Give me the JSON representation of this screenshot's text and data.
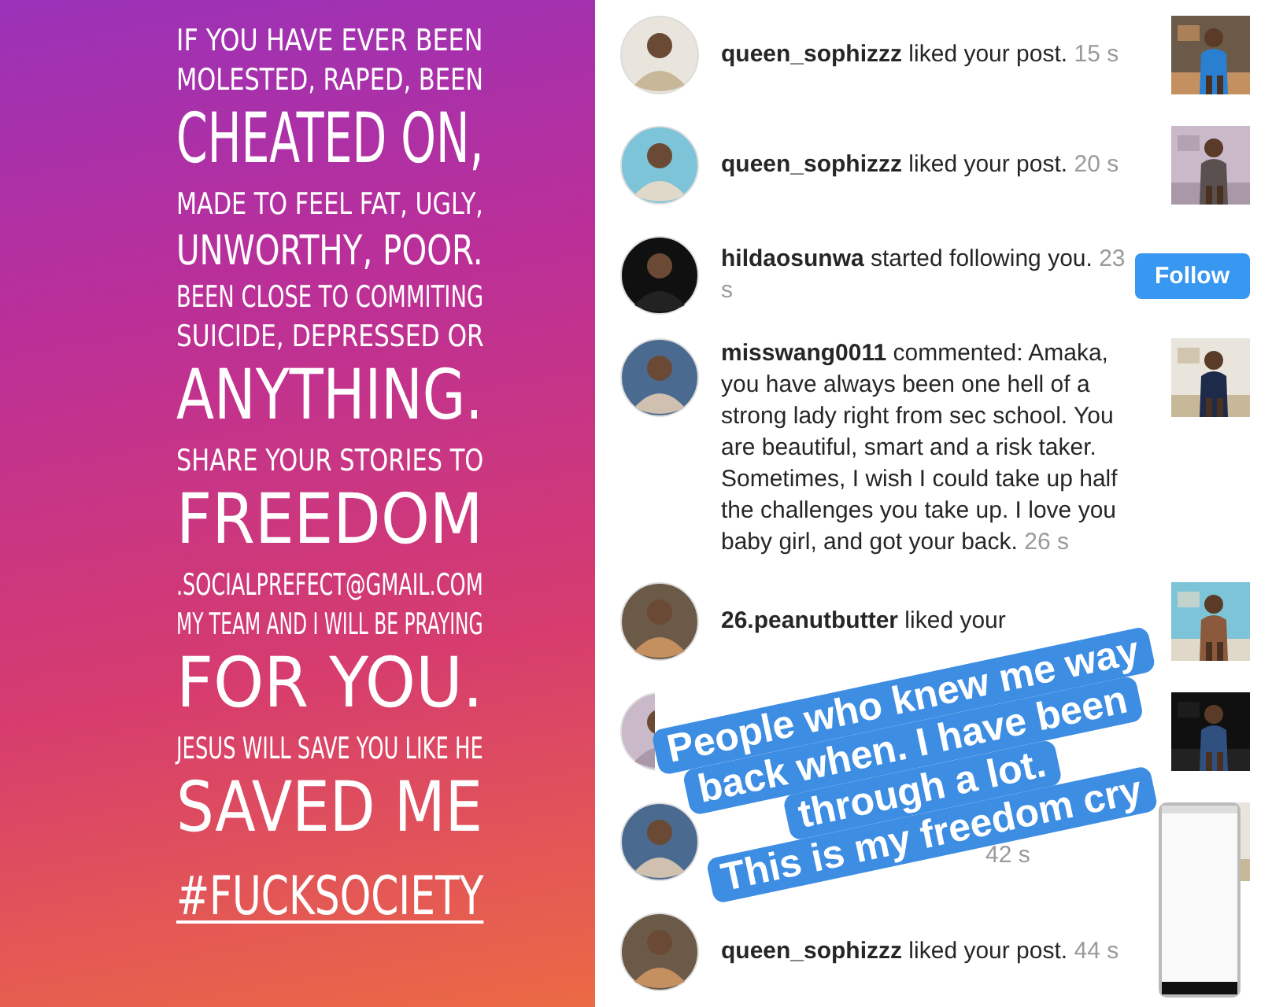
{
  "story": {
    "lines": [
      {
        "text": "IF YOU HAVE EVER BEEN",
        "kind": "small"
      },
      {
        "text": "MOLESTED, RAPED, BEEN",
        "kind": "small"
      },
      {
        "text": "CHEATED ON,",
        "kind": "large"
      },
      {
        "text": "MADE TO FEEL FAT, UGLY,",
        "kind": "small"
      },
      {
        "text": "UNWORTHY, POOR.",
        "kind": "medium"
      },
      {
        "text": "BEEN CLOSE TO COMMITING",
        "kind": "small"
      },
      {
        "text": "SUICIDE, DEPRESSED OR",
        "kind": "small"
      },
      {
        "text": "ANYTHING.",
        "kind": "large"
      },
      {
        "text": "SHARE YOUR STORIES TO",
        "kind": "small"
      },
      {
        "text": "FREEDOM",
        "kind": "large"
      },
      {
        "text": ".SOCIALPREFECT@GMAIL.COM",
        "kind": "small"
      },
      {
        "text": "MY TEAM AND I WILL BE PRAYING",
        "kind": "small"
      },
      {
        "text": "FOR YOU.",
        "kind": "large"
      },
      {
        "text": "JESUS WILL SAVE YOU LIKE HE",
        "kind": "small"
      },
      {
        "text": "SAVED ME",
        "kind": "large"
      },
      {
        "text": "#FUCKSOCIETY",
        "kind": "hashtag"
      }
    ]
  },
  "notifications": [
    {
      "kind": "activity",
      "user": "queen_sophizzz",
      "action": "liked your post.",
      "time": "15 s",
      "trailing": {
        "kind": "thumbnail"
      }
    },
    {
      "kind": "activity",
      "user": "queen_sophizzz",
      "action": "liked your post.",
      "time": "20 s",
      "trailing": {
        "kind": "thumbnail"
      }
    },
    {
      "kind": "activity",
      "user": "hildaosunwa",
      "action": "started following you.",
      "time": "23 s",
      "trailing": {
        "kind": "follow",
        "label": "Follow"
      }
    },
    {
      "kind": "activity",
      "user": "misswang0011",
      "action": "commented: Amaka, you have always been one hell of a strong lady right from sec school. You are beautiful, smart and a risk taker. Sometimes, I wish I could take up half the challenges you take up. I love you baby girl, and got your back.",
      "time": "26 s",
      "trailing": {
        "kind": "thumbnail"
      }
    },
    {
      "kind": "activity",
      "user": "26.peanutbutter",
      "action": "liked your",
      "trailing": {
        "kind": "thumbnail"
      }
    },
    {
      "kind": "covered",
      "trailing": {
        "kind": "thumbnail"
      }
    },
    {
      "kind": "covered",
      "time": "42 s",
      "trailing": {
        "kind": "thumbnail"
      }
    },
    {
      "kind": "activity",
      "user": "queen_sophizzz",
      "action": "liked your post.",
      "time": "44 s"
    }
  ],
  "caption": {
    "lines": [
      "People who knew me way",
      "back when. I have been",
      "through a lot.",
      "This is my freedom cry"
    ]
  }
}
